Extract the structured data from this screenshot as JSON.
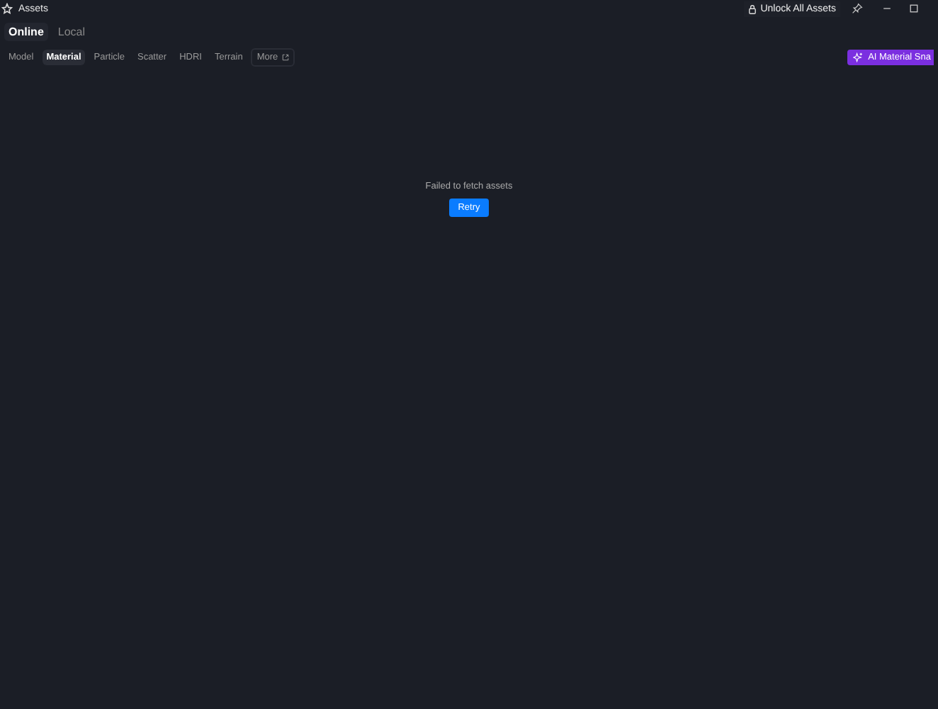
{
  "window": {
    "title": "Assets",
    "unlock_label": "Unlock All Assets"
  },
  "source_tabs": [
    {
      "label": "Online",
      "selected": true
    },
    {
      "label": "Local",
      "selected": false
    }
  ],
  "category_tabs": [
    {
      "label": "Model",
      "selected": false,
      "kind": "tab"
    },
    {
      "label": "Material",
      "selected": true,
      "kind": "tab"
    },
    {
      "label": "Particle",
      "selected": false,
      "kind": "tab"
    },
    {
      "label": "Scatter",
      "selected": false,
      "kind": "tab"
    },
    {
      "label": "HDRI",
      "selected": false,
      "kind": "tab"
    },
    {
      "label": "Terrain",
      "selected": false,
      "kind": "tab"
    },
    {
      "label": "More",
      "selected": false,
      "kind": "external"
    }
  ],
  "ai_button": {
    "label": "AI Material Sna"
  },
  "error": {
    "message": "Failed to fetch assets",
    "retry_label": "Retry"
  }
}
